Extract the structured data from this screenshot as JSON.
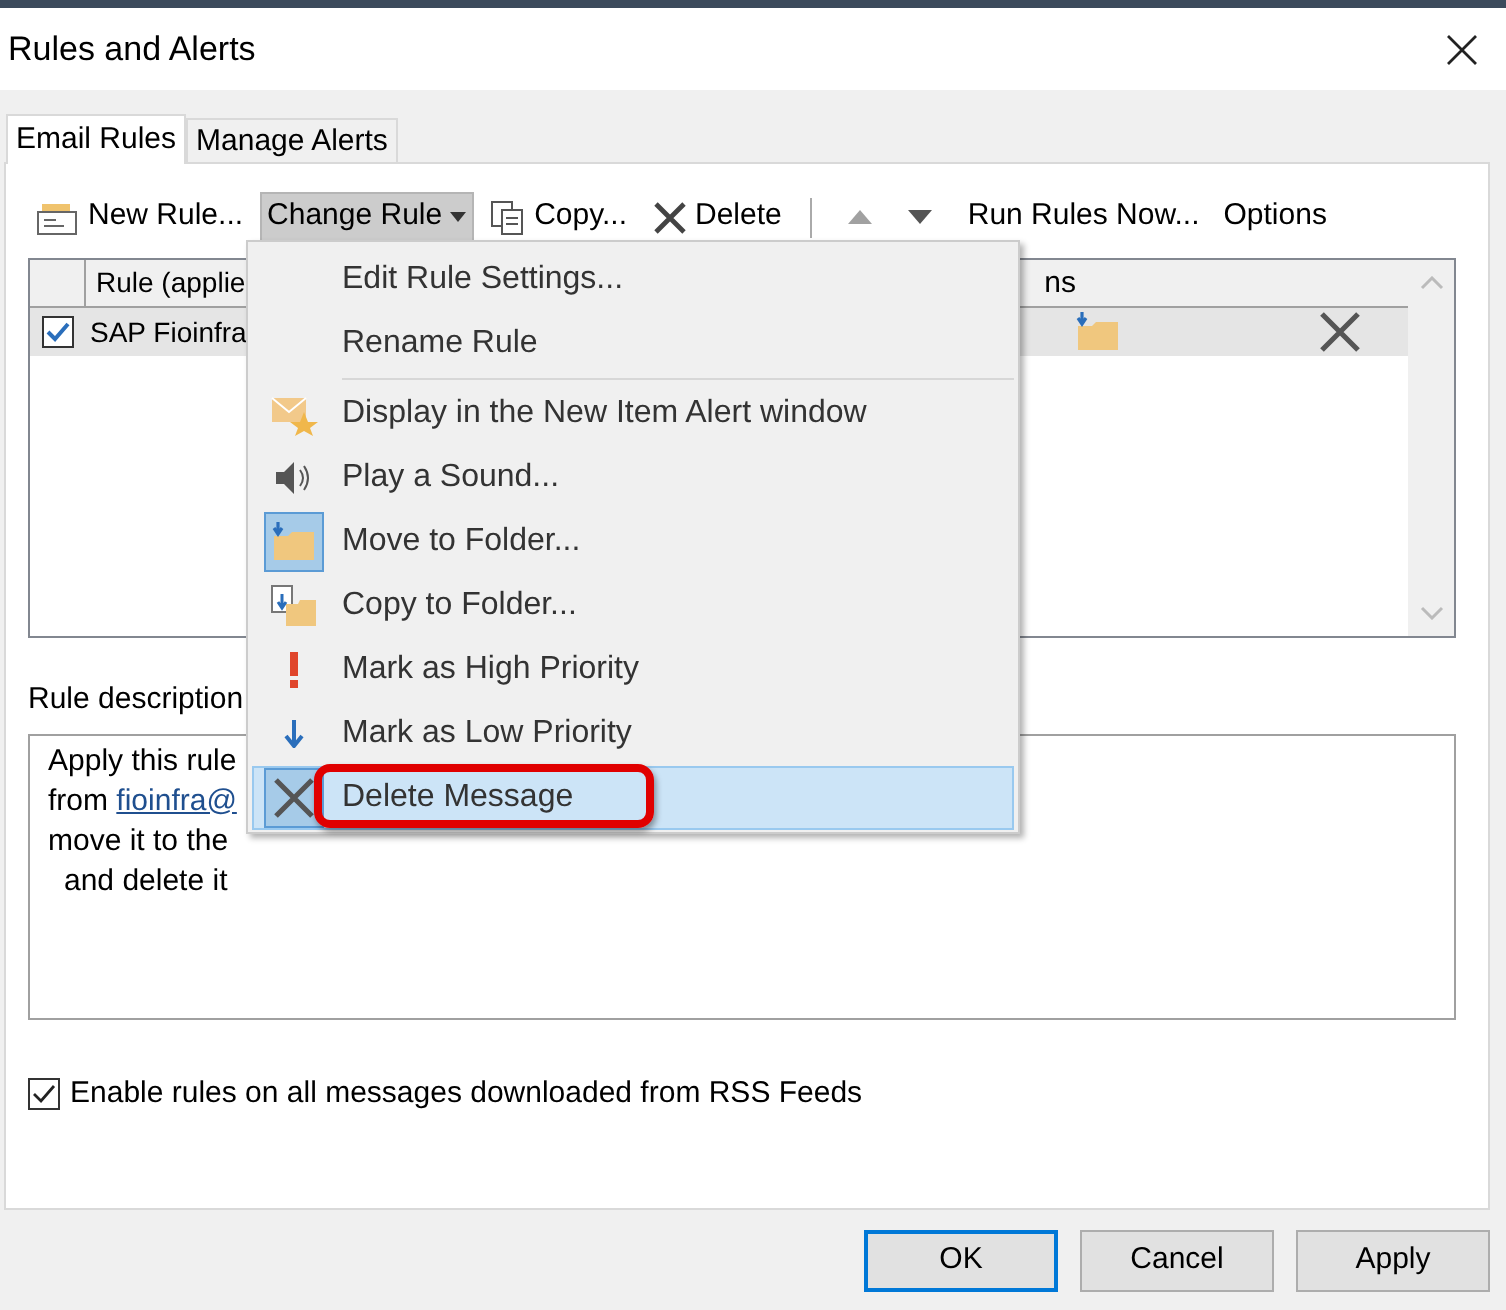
{
  "window": {
    "title": "Rules and Alerts"
  },
  "tabs": [
    {
      "label": "Email Rules",
      "selected": true
    },
    {
      "label": "Manage Alerts",
      "selected": false
    }
  ],
  "toolbar": [
    {
      "kind": "new",
      "label": "New Rule...",
      "pressed": false,
      "disabled": false
    },
    {
      "kind": "change",
      "label": "Change Rule",
      "pressed": true,
      "disabled": false
    },
    {
      "kind": "copy",
      "label": "Copy...",
      "pressed": false,
      "disabled": false
    },
    {
      "kind": "delete",
      "label": "Delete",
      "pressed": false,
      "disabled": false
    },
    {
      "kind": "separator"
    },
    {
      "kind": "up",
      "pressed": false,
      "disabled": true
    },
    {
      "kind": "down",
      "pressed": false,
      "disabled": false
    },
    {
      "kind": "text",
      "label": "Run Rules Now...",
      "pressed": false,
      "disabled": false
    },
    {
      "kind": "text",
      "label": "Options",
      "pressed": false,
      "disabled": false
    }
  ],
  "rules_table": {
    "columns": [
      "Rule (applie",
      "ns"
    ],
    "rows": [
      {
        "checked": true,
        "selected": true,
        "name": "SAP Fioinfra"
      }
    ]
  },
  "description": {
    "label": "Rule description",
    "lines": [
      {
        "parts": [
          {
            "text": "Apply this rule"
          }
        ]
      },
      {
        "parts": [
          {
            "text": "from "
          },
          {
            "text": "fioinfra@",
            "link": true
          }
        ]
      },
      {
        "parts": [
          {
            "text": "move it to the"
          }
        ]
      },
      {
        "parts": [
          {
            "text": "and delete it"
          }
        ],
        "indented": true
      }
    ]
  },
  "rss_option": {
    "label": "Enable rules on all messages downloaded from RSS Feeds",
    "checked": true
  },
  "buttons": [
    {
      "label": "OK",
      "default": true
    },
    {
      "label": "Cancel",
      "default": false
    },
    {
      "label": "Apply",
      "default": false
    }
  ],
  "menu": {
    "items": [
      {
        "kind": "none",
        "label": "Edit Rule Settings...",
        "checked": false,
        "selected": false
      },
      {
        "kind": "none",
        "label": "Rename Rule",
        "checked": false,
        "selected": false
      },
      {
        "kind": "separator"
      },
      {
        "kind": "alert",
        "label": "Display in the New Item Alert window",
        "checked": false,
        "selected": false
      },
      {
        "kind": "sound",
        "label": "Play a Sound...",
        "checked": false,
        "selected": false
      },
      {
        "kind": "move",
        "label": "Move to Folder...",
        "checked": true,
        "selected": false
      },
      {
        "kind": "copy",
        "label": "Copy to Folder...",
        "checked": false,
        "selected": false
      },
      {
        "kind": "high",
        "label": "Mark as High Priority",
        "checked": false,
        "selected": false
      },
      {
        "kind": "low",
        "label": "Mark as Low Priority",
        "checked": false,
        "selected": false
      },
      {
        "kind": "delete",
        "label": "Delete Message",
        "checked": true,
        "selected": true,
        "highlighted": true
      }
    ]
  }
}
